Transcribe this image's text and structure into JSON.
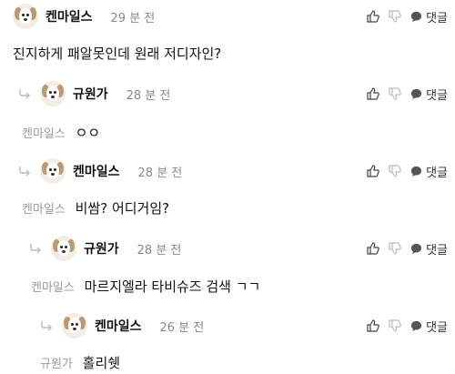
{
  "comments": [
    {
      "author": "켄마일스",
      "time": "29 분 전",
      "mention": "",
      "text": "진지하게 패알못인데 원래 저디자인?",
      "reply_label": "댓글",
      "is_reply": false
    },
    {
      "author": "규원가",
      "time": "28 분 전",
      "mention": "켄마일스",
      "text": "ㅇㅇ",
      "reply_label": "댓글",
      "is_reply": true
    },
    {
      "author": "켄마일스",
      "time": "28 분 전",
      "mention": "켄마일스",
      "text": "비쌈? 어디거임?",
      "reply_label": "댓글",
      "is_reply": true
    },
    {
      "author": "규원가",
      "time": "28 분 전",
      "mention": "켄마일스",
      "text": "마르지엘라 타비슈즈 검색 ㄱㄱ",
      "reply_label": "댓글",
      "is_reply": true
    },
    {
      "author": "켄마일스",
      "time": "26 분 전",
      "mention": "규원가",
      "text": "홀리쉣",
      "reply_label": "댓글",
      "is_reply": true
    }
  ],
  "icons": {
    "like": "thumbs-up-icon",
    "dislike": "thumbs-down-icon",
    "reply": "speech-bubble-icon",
    "reply_arrow": "reply-arrow-icon",
    "avatar": "dog-avatar"
  }
}
